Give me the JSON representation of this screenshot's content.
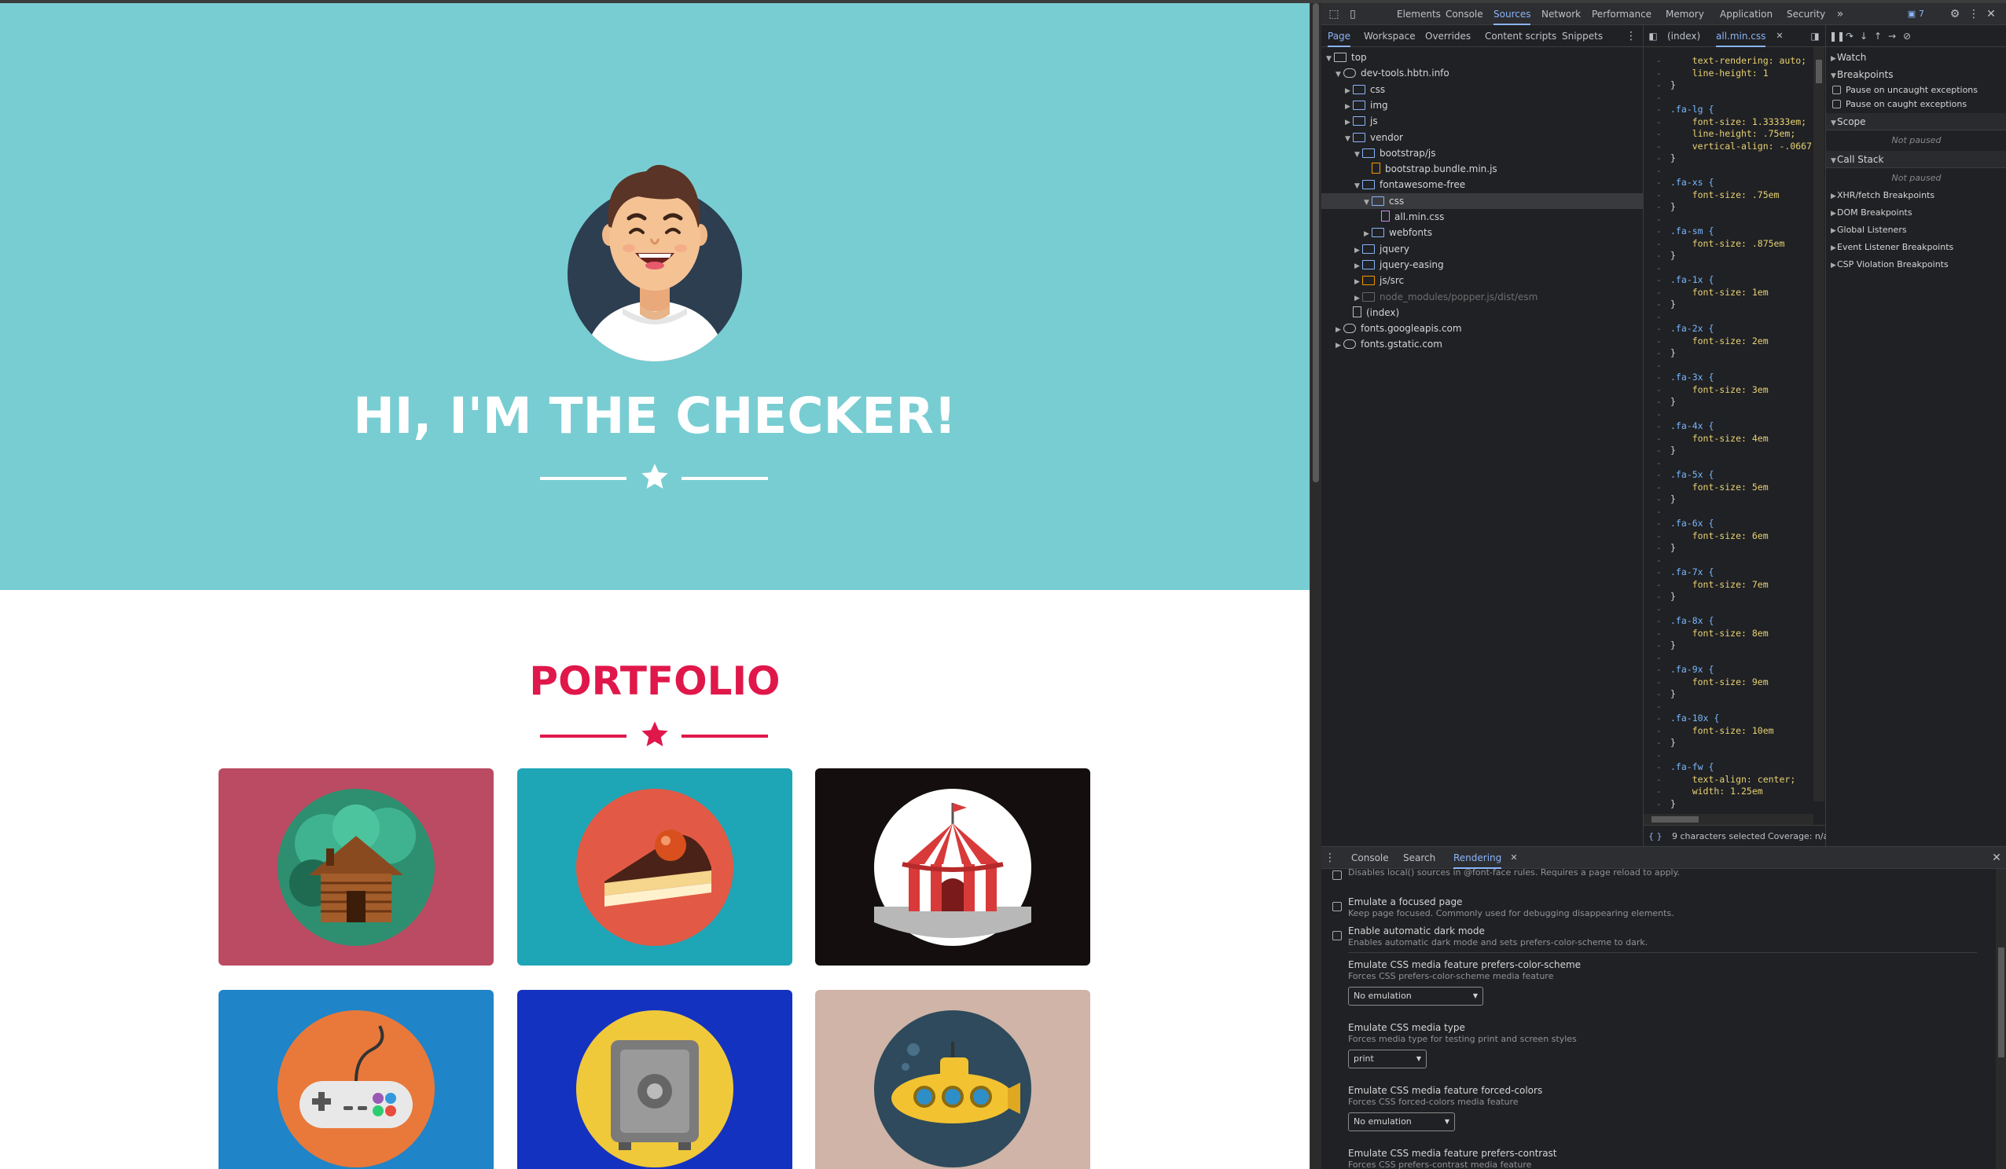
{
  "page": {
    "hero_title": "HI, I'M THE CHECKER!",
    "portfolio_title": "PORTFOLIO",
    "colors": {
      "hero_bg": "#78cdd2",
      "accent": "#e0174a",
      "navy": "#2c3e50"
    },
    "cards": [
      {
        "name": "cabin",
        "bg": "#bb4b62"
      },
      {
        "name": "cake",
        "bg": "#1ea5b6"
      },
      {
        "name": "circus",
        "bg": "#140e0e"
      },
      {
        "name": "game-controller",
        "bg": "#1f84c8"
      },
      {
        "name": "safe",
        "bg": "#1432c0"
      },
      {
        "name": "submarine",
        "bg": "#cfb4a7"
      }
    ]
  },
  "devtools": {
    "main_tabs": [
      "Elements",
      "Console",
      "Sources",
      "Network",
      "Performance",
      "Memory",
      "Application",
      "Security"
    ],
    "active_tab": "Sources",
    "issues_count": "7",
    "navigator_tabs": [
      "Page",
      "Workspace",
      "Overrides",
      "Content scripts",
      "Snippets"
    ],
    "tree": [
      {
        "label": "top",
        "indent": 0,
        "type": "frame",
        "arrow": "▼"
      },
      {
        "label": "dev-tools.hbtn.info",
        "indent": 1,
        "type": "cloud",
        "arrow": "▼"
      },
      {
        "label": "css",
        "indent": 2,
        "type": "folder",
        "arrow": "▶"
      },
      {
        "label": "img",
        "indent": 2,
        "type": "folder",
        "arrow": "▶"
      },
      {
        "label": "js",
        "indent": 2,
        "type": "folder",
        "arrow": "▶"
      },
      {
        "label": "vendor",
        "indent": 2,
        "type": "folder",
        "arrow": "▼"
      },
      {
        "label": "bootstrap/js",
        "indent": 3,
        "type": "folder",
        "arrow": "▼"
      },
      {
        "label": "bootstrap.bundle.min.js",
        "indent": 4,
        "type": "file-js",
        "arrow": ""
      },
      {
        "label": "fontawesome-free",
        "indent": 3,
        "type": "folder",
        "arrow": "▼"
      },
      {
        "label": "css",
        "indent": 4,
        "type": "folder",
        "arrow": "▼",
        "selected": true
      },
      {
        "label": "all.min.css",
        "indent": 5,
        "type": "file-css",
        "arrow": ""
      },
      {
        "label": "webfonts",
        "indent": 4,
        "type": "folder",
        "arrow": "▶"
      },
      {
        "label": "jquery",
        "indent": 3,
        "type": "folder",
        "arrow": "▶"
      },
      {
        "label": "jquery-easing",
        "indent": 3,
        "type": "folder",
        "arrow": "▶"
      },
      {
        "label": "js/src",
        "indent": 3,
        "type": "folder-orange",
        "arrow": "▶"
      },
      {
        "label": "node_modules/popper.js/dist/esm",
        "indent": 3,
        "type": "folder-dim",
        "arrow": "▶",
        "dim": true
      },
      {
        "label": "(index)",
        "indent": 2,
        "type": "file",
        "arrow": ""
      },
      {
        "label": "fonts.googleapis.com",
        "indent": 1,
        "type": "cloud",
        "arrow": "▶"
      },
      {
        "label": "fonts.gstatic.com",
        "indent": 1,
        "type": "cloud",
        "arrow": "▶"
      }
    ],
    "editor_tabs": [
      "(index)",
      "all.min.css"
    ],
    "code_lines": [
      {
        "t": "    text-rendering: auto;",
        "k": "p"
      },
      {
        "t": "    line-height: 1",
        "k": "p"
      },
      {
        "t": "}",
        "k": "b"
      },
      {
        "t": "",
        "k": "b"
      },
      {
        "t": ".fa-lg {",
        "k": "s"
      },
      {
        "t": "    font-size: 1.33333em;",
        "k": "p"
      },
      {
        "t": "    line-height: .75em;",
        "k": "p"
      },
      {
        "t": "    vertical-align: -.0667",
        "k": "p"
      },
      {
        "t": "}",
        "k": "b"
      },
      {
        "t": "",
        "k": "b"
      },
      {
        "t": ".fa-xs {",
        "k": "s"
      },
      {
        "t": "    font-size: .75em",
        "k": "p"
      },
      {
        "t": "}",
        "k": "b"
      },
      {
        "t": "",
        "k": "b"
      },
      {
        "t": ".fa-sm {",
        "k": "s"
      },
      {
        "t": "    font-size: .875em",
        "k": "p"
      },
      {
        "t": "}",
        "k": "b"
      },
      {
        "t": "",
        "k": "b"
      },
      {
        "t": ".fa-1x {",
        "k": "s"
      },
      {
        "t": "    font-size: 1em",
        "k": "p"
      },
      {
        "t": "}",
        "k": "b"
      },
      {
        "t": "",
        "k": "b"
      },
      {
        "t": ".fa-2x {",
        "k": "s"
      },
      {
        "t": "    font-size: 2em",
        "k": "p"
      },
      {
        "t": "}",
        "k": "b"
      },
      {
        "t": "",
        "k": "b"
      },
      {
        "t": ".fa-3x {",
        "k": "s"
      },
      {
        "t": "    font-size: 3em",
        "k": "p"
      },
      {
        "t": "}",
        "k": "b"
      },
      {
        "t": "",
        "k": "b"
      },
      {
        "t": ".fa-4x {",
        "k": "s"
      },
      {
        "t": "    font-size: 4em",
        "k": "p"
      },
      {
        "t": "}",
        "k": "b"
      },
      {
        "t": "",
        "k": "b"
      },
      {
        "t": ".fa-5x {",
        "k": "s"
      },
      {
        "t": "    font-size: 5em",
        "k": "p"
      },
      {
        "t": "}",
        "k": "b"
      },
      {
        "t": "",
        "k": "b"
      },
      {
        "t": ".fa-6x {",
        "k": "s"
      },
      {
        "t": "    font-size: 6em",
        "k": "p"
      },
      {
        "t": "}",
        "k": "b"
      },
      {
        "t": "",
        "k": "b"
      },
      {
        "t": ".fa-7x {",
        "k": "s"
      },
      {
        "t": "    font-size: 7em",
        "k": "p"
      },
      {
        "t": "}",
        "k": "b"
      },
      {
        "t": "",
        "k": "b"
      },
      {
        "t": ".fa-8x {",
        "k": "s"
      },
      {
        "t": "    font-size: 8em",
        "k": "p"
      },
      {
        "t": "}",
        "k": "b"
      },
      {
        "t": "",
        "k": "b"
      },
      {
        "t": ".fa-9x {",
        "k": "s"
      },
      {
        "t": "    font-size: 9em",
        "k": "p"
      },
      {
        "t": "}",
        "k": "b"
      },
      {
        "t": "",
        "k": "b"
      },
      {
        "t": ".fa-10x {",
        "k": "s"
      },
      {
        "t": "    font-size: 10em",
        "k": "p"
      },
      {
        "t": "}",
        "k": "b"
      },
      {
        "t": "",
        "k": "b"
      },
      {
        "t": ".fa-fw {",
        "k": "s"
      },
      {
        "t": "    text-align: center;",
        "k": "p"
      },
      {
        "t": "    width: 1.25em",
        "k": "p"
      },
      {
        "t": "}",
        "k": "b"
      }
    ],
    "editor_status": {
      "selection": "9 characters selected",
      "coverage": "Coverage: n/a"
    },
    "debugger": {
      "watch": "Watch",
      "breakpoints": "Breakpoints",
      "pause_uncaught": "Pause on uncaught exceptions",
      "pause_caught": "Pause on caught exceptions",
      "scope": "Scope",
      "not_paused": "Not paused",
      "call_stack": "Call Stack",
      "sections": [
        "XHR/fetch Breakpoints",
        "DOM Breakpoints",
        "Global Listeners",
        "Event Listener Breakpoints",
        "CSP Violation Breakpoints"
      ]
    },
    "drawer_tabs": [
      "Console",
      "Search",
      "Rendering"
    ],
    "drawer_active": "Rendering",
    "rendering": {
      "local_fonts_sub": "Disables local() sources in @font-face rules. Requires a page reload to apply.",
      "focused_title": "Emulate a focused page",
      "focused_sub": "Keep page focused. Commonly used for debugging disappearing elements.",
      "dark_title": "Enable automatic dark mode",
      "dark_sub": "Enables automatic dark mode and sets prefers-color-scheme to dark.",
      "scheme_title": "Emulate CSS media feature prefers-color-scheme",
      "scheme_sub": "Forces CSS prefers-color-scheme media feature",
      "scheme_value": "No emulation",
      "type_title": "Emulate CSS media type",
      "type_sub": "Forces media type for testing print and screen styles",
      "type_value": "print",
      "forced_title": "Emulate CSS media feature forced-colors",
      "forced_sub": "Forces CSS forced-colors media feature",
      "forced_value": "No emulation",
      "contrast_title": "Emulate CSS media feature prefers-contrast",
      "contrast_sub": "Forces CSS prefers-contrast media feature"
    }
  }
}
